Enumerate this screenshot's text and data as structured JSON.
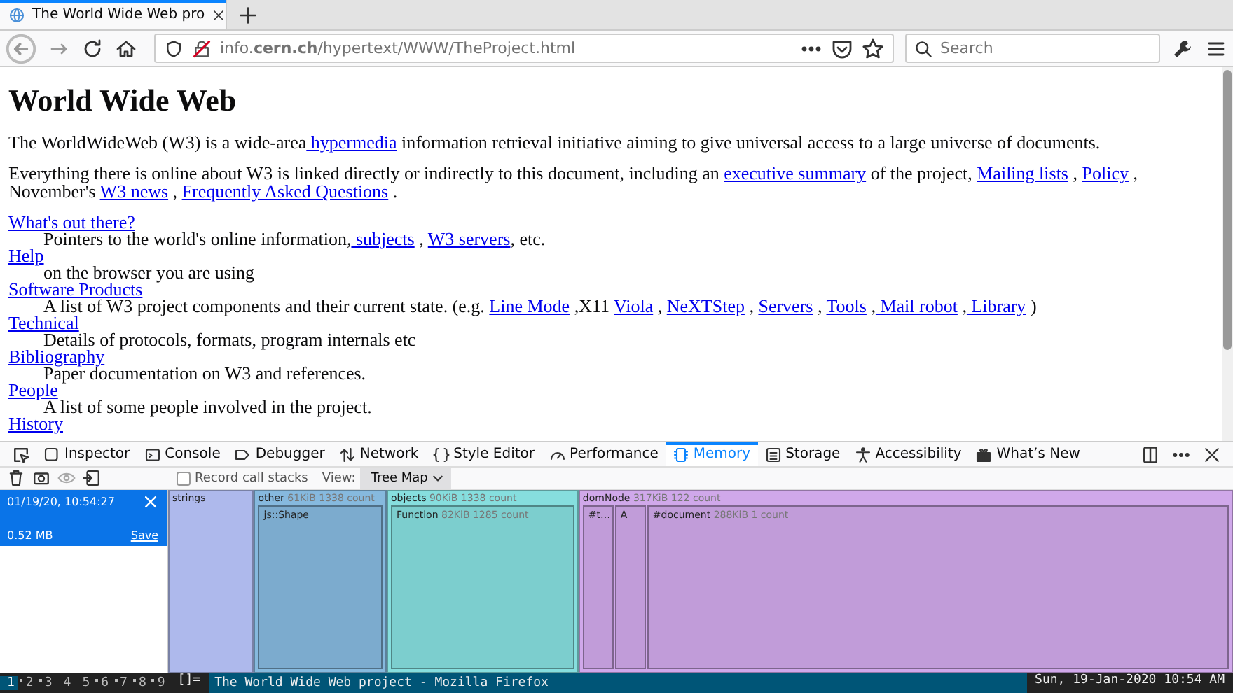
{
  "browser_tab": {
    "title": "The World Wide Web pro",
    "selected": true
  },
  "address_bar": {
    "url": "info.**cern.ch**/hypertext/WWW/TheProject.html"
  },
  "search": {
    "placeholder": "Search"
  },
  "page": {
    "heading": "World Wide Web",
    "paragraphs": [
      [
        {
          "kind": "text",
          "text": "The WorldWideWeb (W3) is a wide-area"
        },
        {
          "kind": "link",
          "text": " hypermedia"
        },
        {
          "kind": "text",
          "text": " information retrieval initiative aiming to give universal access to a large universe of documents."
        }
      ],
      [
        {
          "kind": "text",
          "text": "Everything there is online about W3 is linked directly or indirectly to this document, including an "
        },
        {
          "kind": "link",
          "text": "executive summary"
        },
        {
          "kind": "text",
          "text": " of the project, "
        },
        {
          "kind": "link",
          "text": "Mailing lists"
        },
        {
          "kind": "text",
          "text": " , "
        },
        {
          "kind": "link",
          "text": "Policy"
        },
        {
          "kind": "text",
          "text": " , November's "
        },
        {
          "kind": "link",
          "text": "W3 news"
        },
        {
          "kind": "text",
          "text": " , "
        },
        {
          "kind": "link",
          "text": "Frequently Asked Questions"
        },
        {
          "kind": "text",
          "text": " ."
        }
      ]
    ],
    "definitions": [
      {
        "term": "What's out there?",
        "description": [
          {
            "kind": "text",
            "text": "Pointers to the world's online information,"
          },
          {
            "kind": "link",
            "text": " subjects"
          },
          {
            "kind": "text",
            "text": " , "
          },
          {
            "kind": "link",
            "text": "W3 servers"
          },
          {
            "kind": "text",
            "text": ", etc."
          }
        ]
      },
      {
        "term": "Help",
        "description": [
          {
            "kind": "text",
            "text": "on the browser you are using"
          }
        ]
      },
      {
        "term": "Software Products",
        "description": [
          {
            "kind": "text",
            "text": "A list of W3 project components and their current state. (e.g. "
          },
          {
            "kind": "link",
            "text": "Line Mode"
          },
          {
            "kind": "text",
            "text": " ,X11 "
          },
          {
            "kind": "link",
            "text": "Viola"
          },
          {
            "kind": "text",
            "text": " , "
          },
          {
            "kind": "link",
            "text": "NeXTStep"
          },
          {
            "kind": "text",
            "text": " , "
          },
          {
            "kind": "link",
            "text": "Servers"
          },
          {
            "kind": "text",
            "text": " , "
          },
          {
            "kind": "link",
            "text": "Tools"
          },
          {
            "kind": "text",
            "text": " ,"
          },
          {
            "kind": "link",
            "text": " Mail robot"
          },
          {
            "kind": "text",
            "text": " ,"
          },
          {
            "kind": "link",
            "text": " Library"
          },
          {
            "kind": "text",
            "text": " )"
          }
        ]
      },
      {
        "term": "Technical",
        "description": [
          {
            "kind": "text",
            "text": "Details of protocols, formats, program internals etc"
          }
        ]
      },
      {
        "term": "Bibliography",
        "description": [
          {
            "kind": "text",
            "text": "Paper documentation on W3 and references."
          }
        ]
      },
      {
        "term": "People",
        "description": [
          {
            "kind": "text",
            "text": "A list of some people involved in the project."
          }
        ]
      },
      {
        "term": "History"
      }
    ]
  },
  "devtools": {
    "tabs": [
      {
        "label": "Inspector",
        "selected": false
      },
      {
        "label": "Console",
        "selected": false
      },
      {
        "label": "Debugger",
        "selected": false
      },
      {
        "label": "Network",
        "selected": false
      },
      {
        "label": "Style Editor",
        "selected": false
      },
      {
        "label": "Performance",
        "selected": false
      },
      {
        "label": "Memory",
        "selected": true
      },
      {
        "label": "Storage",
        "selected": false
      },
      {
        "label": "Accessibility",
        "selected": false
      },
      {
        "label": "What’s New",
        "selected": false
      }
    ],
    "record_call_stacks": {
      "label": "Record call stacks",
      "checked": false
    },
    "view": {
      "label": "View:",
      "value": "Tree Map"
    },
    "snapshots": [
      {
        "time": "01/19/20, 10:54:27",
        "size": "0.52 MB",
        "save": "Save",
        "selected": true
      }
    ],
    "treemap": [
      {
        "name": "strings",
        "color": "#aeb9ec"
      },
      {
        "name": "other",
        "detail": "61KiB 1338 count",
        "color": "#86b9de",
        "children": [
          {
            "name": "js::Shape"
          }
        ]
      },
      {
        "name": "objects",
        "detail": "90KiB 1338 count",
        "color": "#86dede",
        "children": [
          {
            "name": "Function",
            "detail": "82KiB 1285 count"
          }
        ]
      },
      {
        "name": "domNode",
        "detail": "317KiB 122 count",
        "color": "#d0a8ea",
        "children": [
          {
            "name": "#t…"
          },
          {
            "name": "A"
          },
          {
            "name": "#document",
            "detail": "288KiB 1 count"
          }
        ]
      }
    ]
  },
  "taskbar": {
    "workspaces": [
      {
        "label": "1",
        "selected": true,
        "occupied": true
      },
      {
        "label": "2",
        "selected": false,
        "occupied": true
      },
      {
        "label": "3",
        "selected": false,
        "occupied": true
      },
      {
        "label": "4",
        "selected": false,
        "occupied": false
      },
      {
        "label": "5",
        "selected": false,
        "occupied": false
      },
      {
        "label": "6",
        "selected": false,
        "occupied": true
      },
      {
        "label": "7",
        "selected": false,
        "occupied": true
      },
      {
        "label": "8",
        "selected": false,
        "occupied": true
      },
      {
        "label": "9",
        "selected": false,
        "occupied": true
      }
    ],
    "layout": "[]=",
    "window_title": "The World Wide Web project - Mozilla Firefox",
    "clock": "Sun, 19-Jan-2020 10:54 AM"
  }
}
